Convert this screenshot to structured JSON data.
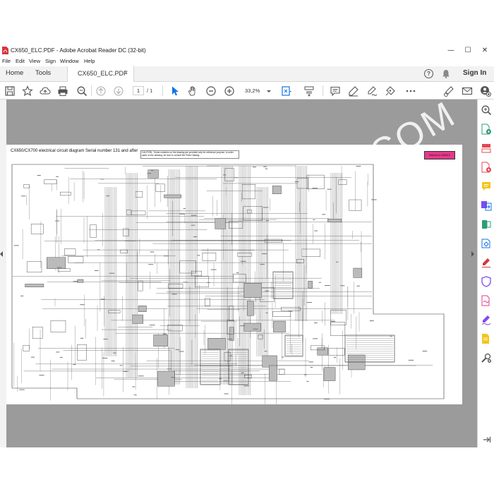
{
  "window": {
    "title": "CX650_ELC.PDF - Adobe Acrobat Reader DC (32-bit)",
    "minimize": "—",
    "maximize": "☐",
    "close": "✕"
  },
  "menu": {
    "items": [
      "File",
      "Edit",
      "View",
      "Sign",
      "Window",
      "Help"
    ]
  },
  "tabs": {
    "home": "Home",
    "tools": "Tools",
    "document": "CX650_ELC.PDF",
    "close": "×",
    "help": "?",
    "sign_in": "Sign In"
  },
  "toolbar": {
    "current_page": "1",
    "total_pages": "/ 1",
    "zoom": "33,2%"
  },
  "document": {
    "title": "CX650/CX700 electrical circuit diagram Serial number 131 and after",
    "caution": "CAUTION : Some numbers on the drawing are provided only for reference purpose, to order parts on the drawing, be sure to consult the Parts Catalog.",
    "return_button": "Return to INDEX",
    "watermark": "COM"
  },
  "colors": {
    "accent_blue": "#1473e6",
    "return_pink": "#e5398a",
    "viewer_gray": "#9b9b9b"
  }
}
